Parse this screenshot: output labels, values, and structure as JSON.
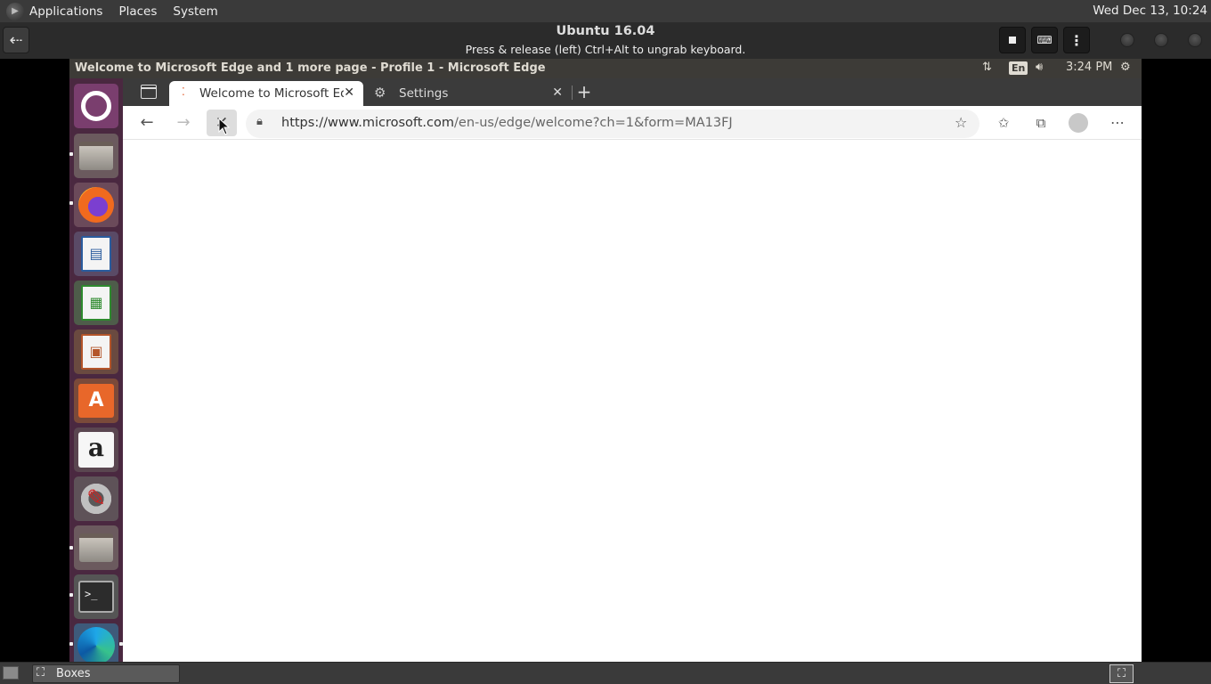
{
  "host": {
    "menus": [
      "Applications",
      "Places",
      "System"
    ],
    "clock": "Wed Dec 13, 10:24"
  },
  "boxes": {
    "title": "Ubuntu 16.04",
    "subtitle": "Press & release (left) Ctrl+Alt to ungrab keyboard."
  },
  "vm": {
    "window_title": "Welcome to Microsoft Edge and 1 more page - Profile 1 - Microsoft Edge",
    "keyboard_layout": "En",
    "time": "3:24 PM"
  },
  "browser": {
    "tabs": [
      {
        "title": "Welcome to Microsoft Edge",
        "active": true
      },
      {
        "title": "Settings",
        "active": false
      }
    ],
    "url_domain": "https://www.microsoft.com",
    "url_path": "/en-us/edge/welcome?ch=1&form=MA13FJ"
  },
  "taskbar": {
    "item": "Boxes"
  },
  "colors": {
    "launcher_bg": "#4a2840",
    "vm_titlebar": "#3d3b37",
    "tabstrip": "#3b3b3b"
  }
}
